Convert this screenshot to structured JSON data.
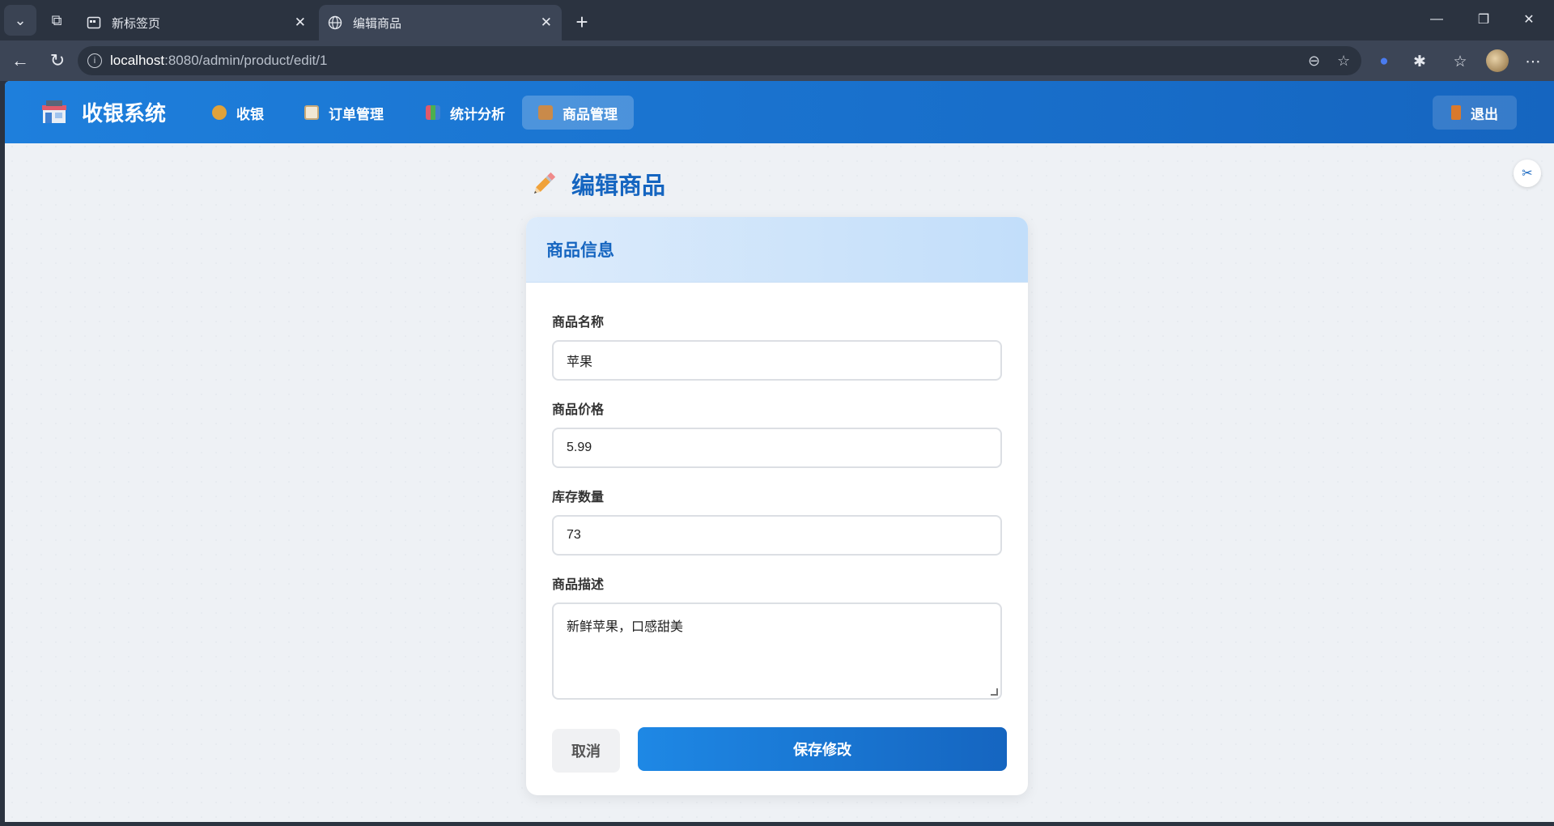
{
  "browser": {
    "tabs": [
      {
        "title": "新标签页",
        "active": false
      },
      {
        "title": "编辑商品",
        "active": true
      }
    ],
    "url_host": "localhost",
    "url_path": ":8080/admin/product/edit/1"
  },
  "app": {
    "brand": "收银系统",
    "nav": [
      {
        "label": "收银",
        "icon": "money-bag-icon",
        "active": false
      },
      {
        "label": "订单管理",
        "icon": "clipboard-icon",
        "active": false
      },
      {
        "label": "统计分析",
        "icon": "bar-chart-icon",
        "active": false
      },
      {
        "label": "商品管理",
        "icon": "package-icon",
        "active": true
      }
    ],
    "logout_label": "退出",
    "accent": "#1565c0"
  },
  "page": {
    "title": "编辑商品",
    "card_title": "商品信息",
    "fields": {
      "name_label": "商品名称",
      "name_value": "苹果",
      "price_label": "商品价格",
      "price_value": "5.99",
      "stock_label": "库存数量",
      "stock_value": "73",
      "desc_label": "商品描述",
      "desc_value": "新鲜苹果，口感甜美"
    },
    "cancel_label": "取消",
    "save_label": "保存修改"
  }
}
